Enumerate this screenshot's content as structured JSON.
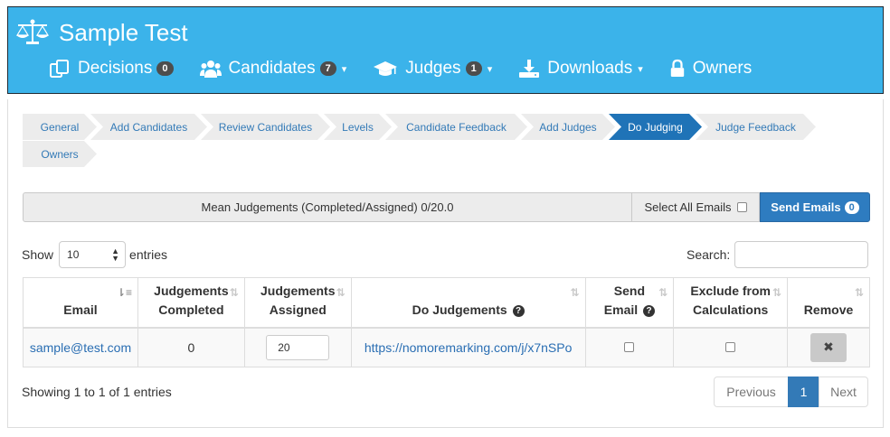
{
  "app": {
    "title": "Sample Test"
  },
  "nav": {
    "decisions": {
      "label": "Decisions",
      "badge": "0"
    },
    "candidates": {
      "label": "Candidates",
      "badge": "7"
    },
    "judges": {
      "label": "Judges",
      "badge": "1"
    },
    "downloads": {
      "label": "Downloads"
    },
    "owners": {
      "label": "Owners"
    },
    "caret": "▾"
  },
  "steps": [
    "General",
    "Add Candidates",
    "Review Candidates",
    "Levels",
    "Candidate Feedback",
    "Add Judges",
    "Do Judging",
    "Judge Feedback",
    "Owners"
  ],
  "toolbar": {
    "mean": "Mean Judgements (Completed/Assigned) 0/20.0",
    "select_all": "Select All Emails",
    "send": "Send Emails",
    "send_badge": "0"
  },
  "length": {
    "show": "Show",
    "value": "10",
    "entries": "entries"
  },
  "search": {
    "label": "Search:",
    "value": ""
  },
  "table": {
    "headers": {
      "email": "Email",
      "completed_1": "Judgements",
      "completed_2": "Completed",
      "assigned_1": "Judgements",
      "assigned_2": "Assigned",
      "do": "Do Judgements",
      "send_1": "Send",
      "send_2": "Email",
      "exclude_1": "Exclude from",
      "exclude_2": "Calculations",
      "remove": "Remove"
    },
    "rows": [
      {
        "email": "sample@test.com",
        "completed": "0",
        "assigned": "20",
        "link": "https://nomoremarking.com/j/x7nSPo",
        "send_email": false,
        "exclude": false
      }
    ]
  },
  "footer": {
    "info": "Showing 1 to 1 of 1 entries",
    "previous": "Previous",
    "page": "1",
    "next": "Next"
  },
  "colors": {
    "header": "#3bb3ea",
    "active_step": "#1f73b7",
    "primary": "#337ab7"
  },
  "icons": {
    "brand": "scales-icon",
    "decisions": "copy-icon",
    "candidates": "users-icon",
    "judges": "graduation-cap-icon",
    "downloads": "download-icon",
    "owners": "lock-icon"
  }
}
